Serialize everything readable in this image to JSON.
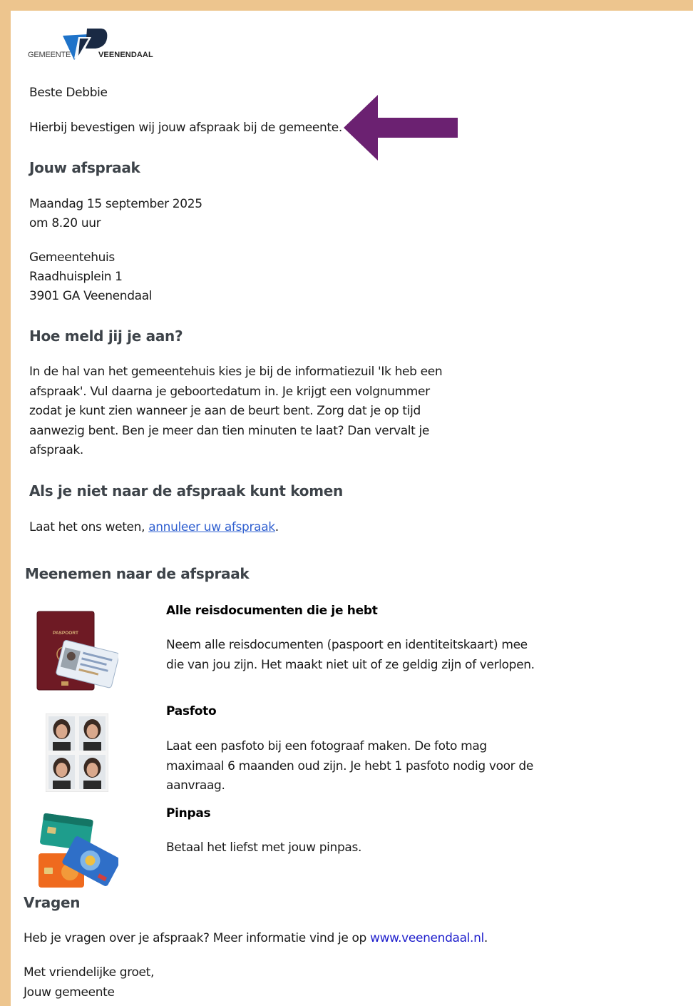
{
  "logo": {
    "prefix": "GEMEENTE",
    "name": "VEENENDAAL"
  },
  "greeting": "Beste Debbie",
  "intro": "Hierbij bevestigen wij jouw afspraak bij de gemeente.",
  "appointment": {
    "heading": "Jouw afspraak",
    "date": "Maandag 15 september 2025",
    "time": "om 8.20 uur",
    "location": [
      "Gemeentehuis",
      "Raadhuisplein 1",
      "3901 GA Veenendaal"
    ]
  },
  "checkin": {
    "heading": "Hoe meld jij je aan?",
    "lines": [
      "In de hal van het gemeentehuis kies je bij de informatiezuil 'Ik heb een",
      "afspraak'. Vul daarna je geboortedatum in. Je krijgt een volgnummer",
      "zodat je kunt zien wanneer je aan de beurt bent. Zorg dat je op tijd",
      "aanwezig bent. Ben je meer dan tien minuten te laat? Dan vervalt je",
      "afspraak."
    ]
  },
  "cancel": {
    "heading": "Als je niet naar de afspraak kunt komen",
    "text_before": "Laat het ons weten, ",
    "link": "annuleer uw afspraak",
    "text_after": "."
  },
  "bring": {
    "heading": "Meenemen naar de afspraak",
    "items": [
      {
        "title": "Alle reisdocumenten die je hebt",
        "lines": [
          "Neem alle reisdocumenten (paspoort en identiteitskaart) mee",
          "die van jou zijn. Het maakt niet uit of ze geldig zijn of verlopen."
        ],
        "image_label": "PASPOORT"
      },
      {
        "title": "Pasfoto",
        "lines": [
          "Laat een pasfoto bij een fotograaf maken. De foto mag",
          "maximaal 6 maanden oud zijn. Je hebt 1 pasfoto nodig voor de",
          "aanvraag."
        ]
      },
      {
        "title": "Pinpas",
        "lines": [
          "Betaal het liefst met jouw pinpas."
        ]
      }
    ]
  },
  "questions": {
    "heading": "Vragen",
    "text_before": "Heb je vragen over je afspraak? Meer informatie vind je op ",
    "link": "www.veenendaal.nl",
    "text_after": "."
  },
  "closing": [
    "Met vriendelijke groet,",
    "Jouw gemeente"
  ],
  "colors": {
    "frame": "#edc58e",
    "arrow": "#6b2171",
    "heading": "#3d4349",
    "link": "#2f5fd0",
    "logo_blue": "#1f73c9"
  }
}
